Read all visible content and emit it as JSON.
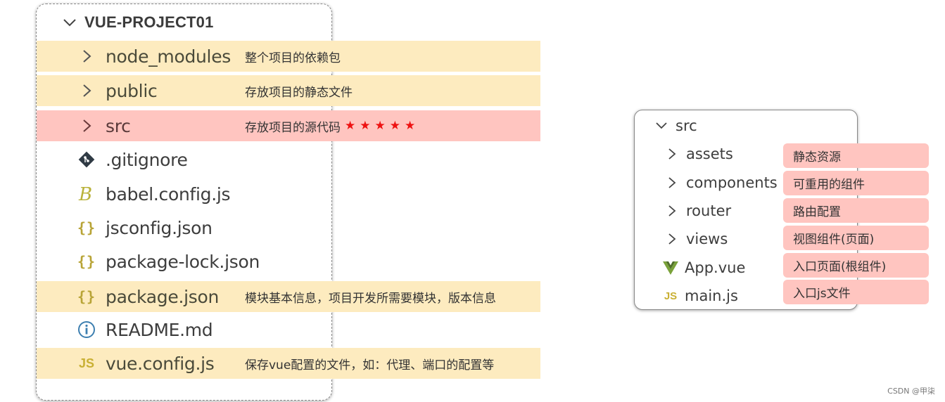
{
  "left_tree": {
    "root": {
      "label": "VUE-PROJECT01",
      "icon": "chevron-down-icon"
    },
    "items": [
      {
        "name": "node_modules",
        "icon": "chevron-right-icon",
        "highlight": "yellow",
        "note": "整个项目的依赖包"
      },
      {
        "name": "public",
        "icon": "chevron-right-icon",
        "highlight": "yellow",
        "note": "存放项目的静态文件"
      },
      {
        "name": "src",
        "icon": "chevron-right-icon",
        "highlight": "red",
        "note": "存放项目的源代码",
        "stars": "★★★★★"
      },
      {
        "name": ".gitignore",
        "icon": "git-icon",
        "highlight": "none",
        "note": ""
      },
      {
        "name": "babel.config.js",
        "icon": "babel-icon",
        "highlight": "none",
        "note": ""
      },
      {
        "name": "jsconfig.json",
        "icon": "json-braces-icon",
        "highlight": "none",
        "note": ""
      },
      {
        "name": "package-lock.json",
        "icon": "json-braces-icon",
        "highlight": "none",
        "note": ""
      },
      {
        "name": "package.json",
        "icon": "json-braces-icon",
        "highlight": "yellow",
        "note": "模块基本信息，项目开发所需要模块，版本信息"
      },
      {
        "name": "README.md",
        "icon": "info-icon",
        "highlight": "none",
        "note": ""
      },
      {
        "name": "vue.config.js",
        "icon": "js-icon",
        "highlight": "yellow",
        "note": "保存vue配置的文件，如：代理、端口的配置等"
      }
    ]
  },
  "right_tree": {
    "root": {
      "label": "src",
      "icon": "chevron-down-icon"
    },
    "items": [
      {
        "name": "assets",
        "icon": "chevron-right-icon",
        "tag": "静态资源"
      },
      {
        "name": "components",
        "icon": "chevron-right-icon",
        "tag": "可重用的组件"
      },
      {
        "name": "router",
        "icon": "chevron-right-icon",
        "tag": "路由配置"
      },
      {
        "name": "views",
        "icon": "chevron-right-icon",
        "tag": "视图组件(页面)"
      },
      {
        "name": "App.vue",
        "icon": "vue-icon",
        "tag": "入口页面(根组件)"
      },
      {
        "name": "main.js",
        "icon": "js-icon",
        "tag": "入口js文件"
      }
    ]
  },
  "colors": {
    "yellow_band": "#fdebbf",
    "red_band": "#ffc5c0",
    "star": "#ee1111",
    "json_icon": "#b8a437",
    "js_icon": "#c9b034",
    "vue_icon": "#7aa23a",
    "info_icon": "#3d7fb0"
  },
  "watermark": "CSDN @甲柒"
}
